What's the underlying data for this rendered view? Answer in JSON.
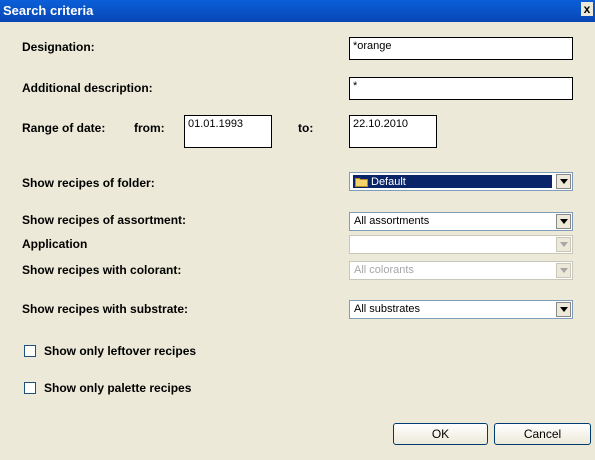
{
  "window": {
    "title": "Search criteria",
    "close_label": "x"
  },
  "fields": {
    "designation": {
      "label": "Designation:",
      "value": "*orange"
    },
    "additional_description": {
      "label": "Additional description:",
      "value": "*"
    },
    "date_range": {
      "label": "Range of date:",
      "from_label": "from:",
      "from_value": "01.01.1993",
      "to_label": "to:",
      "to_value": "22.10.2010"
    }
  },
  "dropdowns": {
    "folder": {
      "label": "Show recipes of folder:",
      "value": "Default",
      "icon": "folder-icon"
    },
    "assortment": {
      "label": "Show recipes of assortment:",
      "value": "All assortments"
    },
    "application": {
      "label": "Application",
      "value": ""
    },
    "colorant": {
      "label": "Show recipes with colorant:",
      "value": "All colorants"
    },
    "substrate": {
      "label": "Show recipes with substrate:",
      "value": "All substrates"
    }
  },
  "checkboxes": {
    "leftover": {
      "label": "Show only leftover recipes",
      "checked": false
    },
    "palette": {
      "label": "Show only palette recipes",
      "checked": false
    }
  },
  "buttons": {
    "ok": "OK",
    "cancel": "Cancel"
  }
}
